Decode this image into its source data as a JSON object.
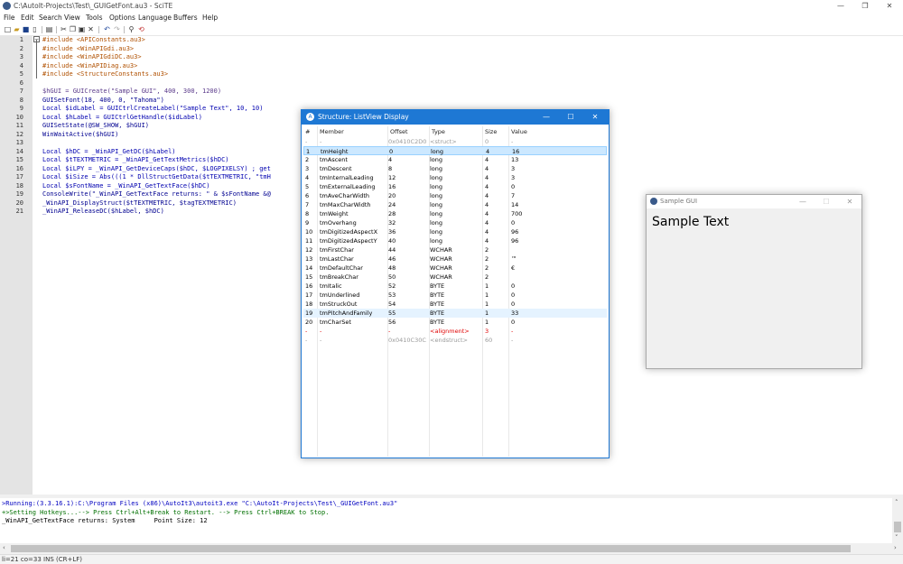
{
  "window": {
    "title": "C:\\AutoIt-Projects\\Test\\_GUIGetFont.au3 - SciTE",
    "minimize": "—",
    "maximize": "❐",
    "close": "✕"
  },
  "menu": [
    "File",
    "Edit",
    "Search",
    "View",
    "Tools",
    "Options",
    "Language",
    "Buffers",
    "Help"
  ],
  "toolbar_icons": [
    "new-icon",
    "open-icon",
    "save-icon",
    "close-file-icon",
    "print-icon",
    "cut-icon",
    "copy-icon",
    "paste-icon",
    "delete-icon",
    "undo-icon",
    "redo-icon",
    "find-icon",
    "replace-icon"
  ],
  "editor": {
    "line_numbers": [
      "1",
      "2",
      "3",
      "4",
      "5",
      "6",
      "7",
      "8",
      "9",
      "10",
      "11",
      "12",
      "13",
      "14",
      "15",
      "16",
      "17",
      "18",
      "19",
      "20",
      "21"
    ],
    "lines": [
      "#include <APIConstants.au3>",
      "#include <WinAPIGdi.au3>",
      "#include <WinAPIGdiDC.au3>",
      "#include <WinAPIDiag.au3>",
      "#include <StructureConstants.au3>",
      "",
      "$hGUI = GUICreate(\"Sample GUI\", 400, 300, 1200)",
      "GUISetFont(18, 400, 0, \"Tahoma\")",
      "Local $idLabel = GUICtrlCreateLabel(\"Sample Text\", 10, 10)",
      "Local $hLabel = GUICtrlGetHandle($idLabel)",
      "GUISetState(@SW_SHOW, $hGUI)",
      "WinWaitActive($hGUI)",
      "",
      "Local $hDC = _WinAPI_GetDC($hLabel)",
      "Local $tTEXTMETRIC = _WinAPI_GetTextMetrics($hDC)",
      "Local $iLPY = _WinAPI_GetDeviceCaps($hDC, $LOGPIXELSY) ; get",
      "Local $iSize = Abs(((1 * DllStructGetData($tTEXTMETRIC, \"tmH",
      "Local $sFontName = _WinAPI_GetTextFace($hDC)",
      "ConsoleWrite(\"_WinAPI_GetTextFace returns: \" & $sFontName &@",
      "_WinAPI_DisplayStruct($tTEXTMETRIC, $tagTEXTMETRIC)",
      "_WinAPI_ReleaseDC($hLabel, $hDC)"
    ]
  },
  "output": {
    "lines": [
      ">Running:(3.3.16.1):C:\\Program Files (x86)\\AutoIt3\\autoit3.exe \"C:\\AutoIt-Projects\\Test\\_GUIGetFont.au3\"",
      "+>Setting Hotkeys...--> Press Ctrl+Alt+Break to Restart. --> Press Ctrl+BREAK to Stop.",
      "_WinAPI_GetTextFace returns: System     Point Size: 12"
    ]
  },
  "status": "li=21 co=33 INS (CR+LF)",
  "structure_window": {
    "title": "Structure: ListView Display",
    "columns": [
      "#",
      "Member",
      "Offset",
      "Type",
      "Size",
      "Value"
    ],
    "rows": [
      [
        "-",
        "-",
        "0x0410C2D0",
        "<struct>",
        "0",
        "-"
      ],
      [
        "1",
        "tmHeight",
        "0",
        "long",
        "4",
        "16"
      ],
      [
        "2",
        "tmAscent",
        "4",
        "long",
        "4",
        "13"
      ],
      [
        "3",
        "tmDescent",
        "8",
        "long",
        "4",
        "3"
      ],
      [
        "4",
        "tmInternalLeading",
        "12",
        "long",
        "4",
        "3"
      ],
      [
        "5",
        "tmExternalLeading",
        "16",
        "long",
        "4",
        "0"
      ],
      [
        "6",
        "tmAveCharWidth",
        "20",
        "long",
        "4",
        "7"
      ],
      [
        "7",
        "tmMaxCharWidth",
        "24",
        "long",
        "4",
        "14"
      ],
      [
        "8",
        "tmWeight",
        "28",
        "long",
        "4",
        "700"
      ],
      [
        "9",
        "tmOverhang",
        "32",
        "long",
        "4",
        "0"
      ],
      [
        "10",
        "tmDigitizedAspectX",
        "36",
        "long",
        "4",
        "96"
      ],
      [
        "11",
        "tmDigitizedAspectY",
        "40",
        "long",
        "4",
        "96"
      ],
      [
        "12",
        "tmFirstChar",
        "44",
        "WCHAR",
        "2",
        ""
      ],
      [
        "13",
        "tmLastChar",
        "46",
        "WCHAR",
        "2",
        "™"
      ],
      [
        "14",
        "tmDefaultChar",
        "48",
        "WCHAR",
        "2",
        "€"
      ],
      [
        "15",
        "tmBreakChar",
        "50",
        "WCHAR",
        "2",
        ""
      ],
      [
        "16",
        "tmItalic",
        "52",
        "BYTE",
        "1",
        "0"
      ],
      [
        "17",
        "tmUnderlined",
        "53",
        "BYTE",
        "1",
        "0"
      ],
      [
        "18",
        "tmStruckOut",
        "54",
        "BYTE",
        "1",
        "0"
      ],
      [
        "19",
        "tmPitchAndFamily",
        "55",
        "BYTE",
        "1",
        "33"
      ],
      [
        "20",
        "tmCharSet",
        "56",
        "BYTE",
        "1",
        "0"
      ],
      [
        "-",
        "-",
        "-",
        "<alignment>",
        "3",
        "-"
      ],
      [
        "-",
        "-",
        "0x0410C30C",
        "<endstruct>",
        "60",
        "-"
      ]
    ],
    "selected_row": 1,
    "hover_row": 19,
    "accent_color": "#1e78d4"
  },
  "sample_window": {
    "title": "Sample GUI",
    "label": "Sample Text"
  }
}
